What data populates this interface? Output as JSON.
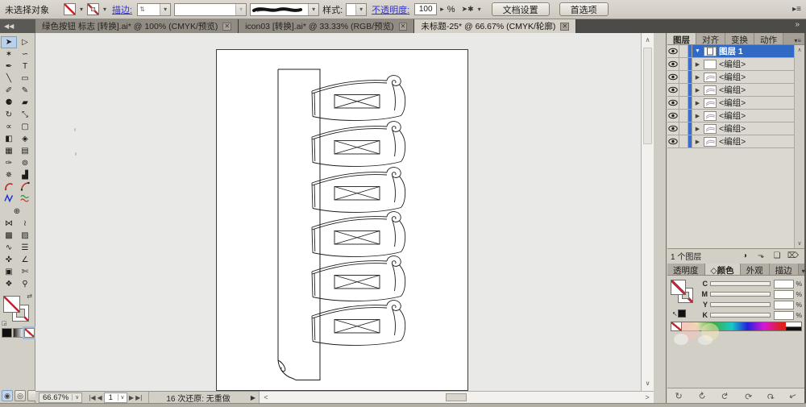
{
  "control_bar": {
    "selection_status": "未选择对象",
    "stroke_label": "描边:",
    "style_label": "样式:",
    "opacity_label": "不透明度:",
    "opacity_value": "100",
    "percent_label": "%",
    "document_setup_label": "文档设置",
    "preferences_label": "首选项"
  },
  "document_tabs": [
    {
      "title": "绿色按钮 标志 [转换].ai* @ 100% (CMYK/预览)",
      "close_glyph": "✕"
    },
    {
      "title": "icon03 [转换].ai* @ 33.33% (RGB/预览)",
      "close_glyph": "✕"
    },
    {
      "title": "未标题-25* @ 66.67% (CMYK/轮廓)",
      "close_glyph": "✕"
    }
  ],
  "toolbar": {
    "collapse_glyph": "◀◀",
    "tools": [
      {
        "name": "selection",
        "glyph": "➤",
        "active": true
      },
      {
        "name": "direct-selection",
        "glyph": "▷"
      },
      {
        "name": "magic-wand",
        "glyph": "✶"
      },
      {
        "name": "lasso",
        "glyph": "∽"
      },
      {
        "name": "pen",
        "glyph": "✒"
      },
      {
        "name": "type",
        "glyph": "T"
      },
      {
        "name": "line-segment",
        "glyph": "╲"
      },
      {
        "name": "rectangle",
        "glyph": "▭"
      },
      {
        "name": "paintbrush",
        "glyph": "✐"
      },
      {
        "name": "pencil",
        "glyph": "✎"
      },
      {
        "name": "blob-brush",
        "glyph": "⚈"
      },
      {
        "name": "eraser",
        "glyph": "▰"
      },
      {
        "name": "rotate",
        "glyph": "↻"
      },
      {
        "name": "scale",
        "glyph": "⤡"
      },
      {
        "name": "width-tool",
        "glyph": "∝"
      },
      {
        "name": "free-transform",
        "glyph": "▢"
      },
      {
        "name": "shape-builder",
        "glyph": "◧"
      },
      {
        "name": "live-paint-bucket",
        "glyph": "◈"
      },
      {
        "name": "perspective-grid",
        "glyph": "▦"
      },
      {
        "name": "mesh",
        "glyph": "▤"
      },
      {
        "name": "eyedropper",
        "glyph": "✑"
      },
      {
        "name": "blend",
        "glyph": "⊚"
      },
      {
        "name": "symbol-sprayer",
        "glyph": "✵"
      },
      {
        "name": "column-graph",
        "glyph": "▟"
      },
      {
        "name": "curvature",
        "svg": "hook"
      },
      {
        "name": "arc",
        "svg": "arc"
      },
      {
        "name": "zigzag",
        "svg": "zigzag"
      },
      {
        "name": "wave-lines",
        "svg": "waves"
      },
      {
        "name": "artboard-target",
        "glyph": "⊕",
        "span": 2
      },
      {
        "name": "warp",
        "glyph": "⋈"
      },
      {
        "name": "flag-warp",
        "glyph": "≀"
      },
      {
        "name": "mesh-grid",
        "glyph": "▩"
      },
      {
        "name": "sketch-hand",
        "glyph": "▨"
      },
      {
        "name": "scribble",
        "glyph": "∿"
      },
      {
        "name": "align-lines",
        "glyph": "☰"
      },
      {
        "name": "measure-dropper",
        "glyph": "✜"
      },
      {
        "name": "measure",
        "glyph": "∠"
      },
      {
        "name": "artboard-frame",
        "glyph": "▣"
      },
      {
        "name": "slice",
        "glyph": "✄"
      },
      {
        "name": "hand",
        "glyph": "❖"
      },
      {
        "name": "zoom-tool",
        "glyph": "⚲"
      }
    ]
  },
  "status_bar": {
    "zoom_value": "66.67%",
    "artboard_value": "1",
    "undo_status": "16 次还原: 无重做"
  },
  "panels": {
    "dock_expand_glyph": "»",
    "group1_tabs": [
      {
        "label": "图层",
        "active": true
      },
      {
        "label": "对齐"
      },
      {
        "label": "变换"
      },
      {
        "label": "动作"
      }
    ],
    "layers": {
      "rows": [
        {
          "label": "图层 1",
          "selected": true,
          "thumb": "page",
          "expanded": true
        },
        {
          "label": "<编组>",
          "thumb": "blank"
        },
        {
          "label": "<编组>",
          "thumb": "ribbon"
        },
        {
          "label": "<编组>",
          "thumb": "ribbon"
        },
        {
          "label": "<编组>",
          "thumb": "ribbon"
        },
        {
          "label": "<编组>",
          "thumb": "ribbon"
        },
        {
          "label": "<编组>",
          "thumb": "ribbon"
        },
        {
          "label": "<编组>",
          "thumb": "ribbon"
        }
      ],
      "footer_count": "1 个图层",
      "footer_buttons": [
        {
          "name": "make-clipping-mask",
          "glyph": "◑"
        },
        {
          "name": "create-sublayer",
          "glyph": "⬎"
        },
        {
          "name": "create-new-layer",
          "glyph": "❏"
        },
        {
          "name": "delete-layer",
          "glyph": "⌦"
        }
      ]
    },
    "group2_tabs": [
      {
        "label": "透明度"
      },
      {
        "label": "颜色",
        "active": true,
        "prefix": "◇"
      },
      {
        "label": "外观"
      },
      {
        "label": "描边"
      }
    ],
    "color": {
      "channels": [
        {
          "label": "C"
        },
        {
          "label": "M"
        },
        {
          "label": "Y"
        },
        {
          "label": "K"
        }
      ],
      "percent_label": "%"
    },
    "bottom_icons": [
      {
        "name": "spin-1",
        "glyph": "↻"
      },
      {
        "name": "spin-2",
        "glyph": "↻"
      },
      {
        "name": "spin-3",
        "glyph": "↻"
      },
      {
        "name": "spin-4",
        "glyph": "↻"
      },
      {
        "name": "spin-5",
        "glyph": "↻"
      },
      {
        "name": "arrow-ne",
        "glyph": "↗"
      }
    ]
  },
  "colors": {
    "selection_blue": "#316ac5",
    "link_blue": "#3434cc",
    "none_red": "#c22828",
    "chrome_gray": "#d2cfc7",
    "tab_bar_dark": "#4c4b48"
  }
}
